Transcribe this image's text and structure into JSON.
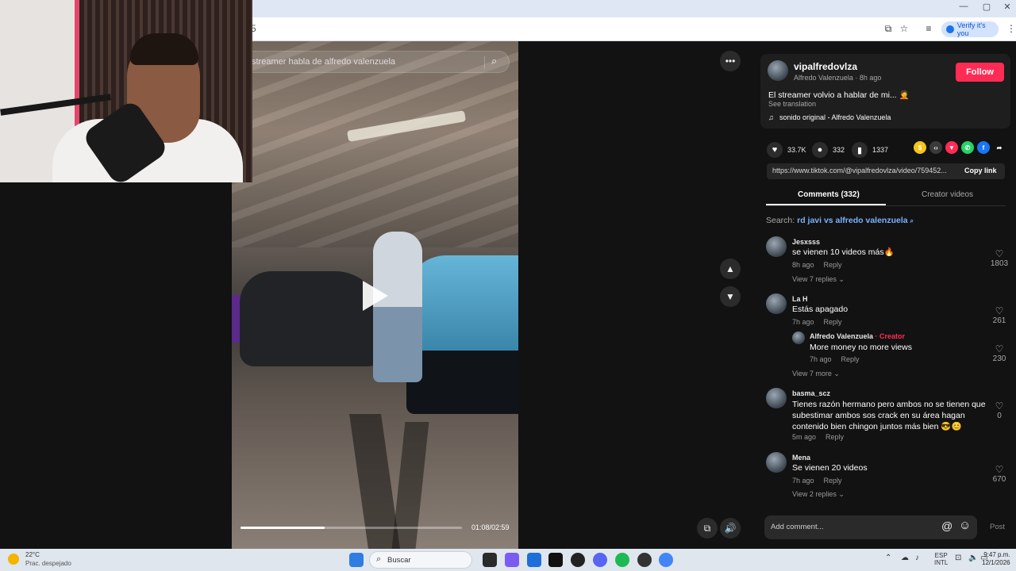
{
  "browser": {
    "url_fragment": "5",
    "verify_label": "Verify it's you"
  },
  "video": {
    "search_query": "streamer habla de alfredo valenzuela",
    "time": "01:08/02:59",
    "progress_fraction": 0.38
  },
  "post": {
    "username": "vipalfredovlza",
    "display_name_time": "Alfredo Valenzuela · 8h ago",
    "follow_label": "Follow",
    "caption": "El streamer volvio a hablar de mi... 🤦",
    "see_translation": "See translation",
    "sound": "sonido original - Alfredo Valenzuela",
    "likes": "33.7K",
    "comments": "332",
    "saves": "1337",
    "link": "https://www.tiktok.com/@vipalfredovlza/video/759452...",
    "copy_link": "Copy link"
  },
  "tabs": {
    "comments": "Comments (332)",
    "creator_videos": "Creator videos"
  },
  "search_suggest": {
    "prefix": "Search:",
    "query": "rd javi vs alfredo valenzuela"
  },
  "comments": [
    {
      "user": "Jesxsss",
      "text": "se vienen 10 videos más🔥",
      "time": "8h ago",
      "reply": "Reply",
      "likes": "1803",
      "more": "View 7 replies ⌄"
    },
    {
      "user": "La H",
      "text": "Estás apagado",
      "time": "7h ago",
      "reply": "Reply",
      "likes": "261"
    },
    {
      "user": "Alfredo Valenzuela",
      "creator_tag": "Creator",
      "text": "More money no more views",
      "time": "7h ago",
      "reply": "Reply",
      "likes": "230",
      "more": "View 7 more ⌄"
    },
    {
      "user": "basma_scz",
      "text": "Tienes razón hermano pero ambos no se tienen que subestimar ambos sos crack en su área hagan contenido bien chingon juntos más bien 😎😊",
      "time": "5m ago",
      "reply": "Reply",
      "likes": "0"
    },
    {
      "user": "Mena",
      "text": "Se vienen 20 videos",
      "time": "7h ago",
      "reply": "Reply",
      "likes": "670",
      "more": "View 2 replies ⌄"
    }
  ],
  "add_comment": {
    "placeholder": "Add comment...",
    "post": "Post"
  },
  "taskbar": {
    "temp": "22°C",
    "weather": "Prac. despejado",
    "search": "Buscar",
    "lang1": "ESP",
    "lang2": "INTL",
    "time": "9:47 p.m.",
    "date": "12/1/2026"
  },
  "colors": {
    "accent": "#fe2c55",
    "link_blue": "#7ab3ff"
  }
}
